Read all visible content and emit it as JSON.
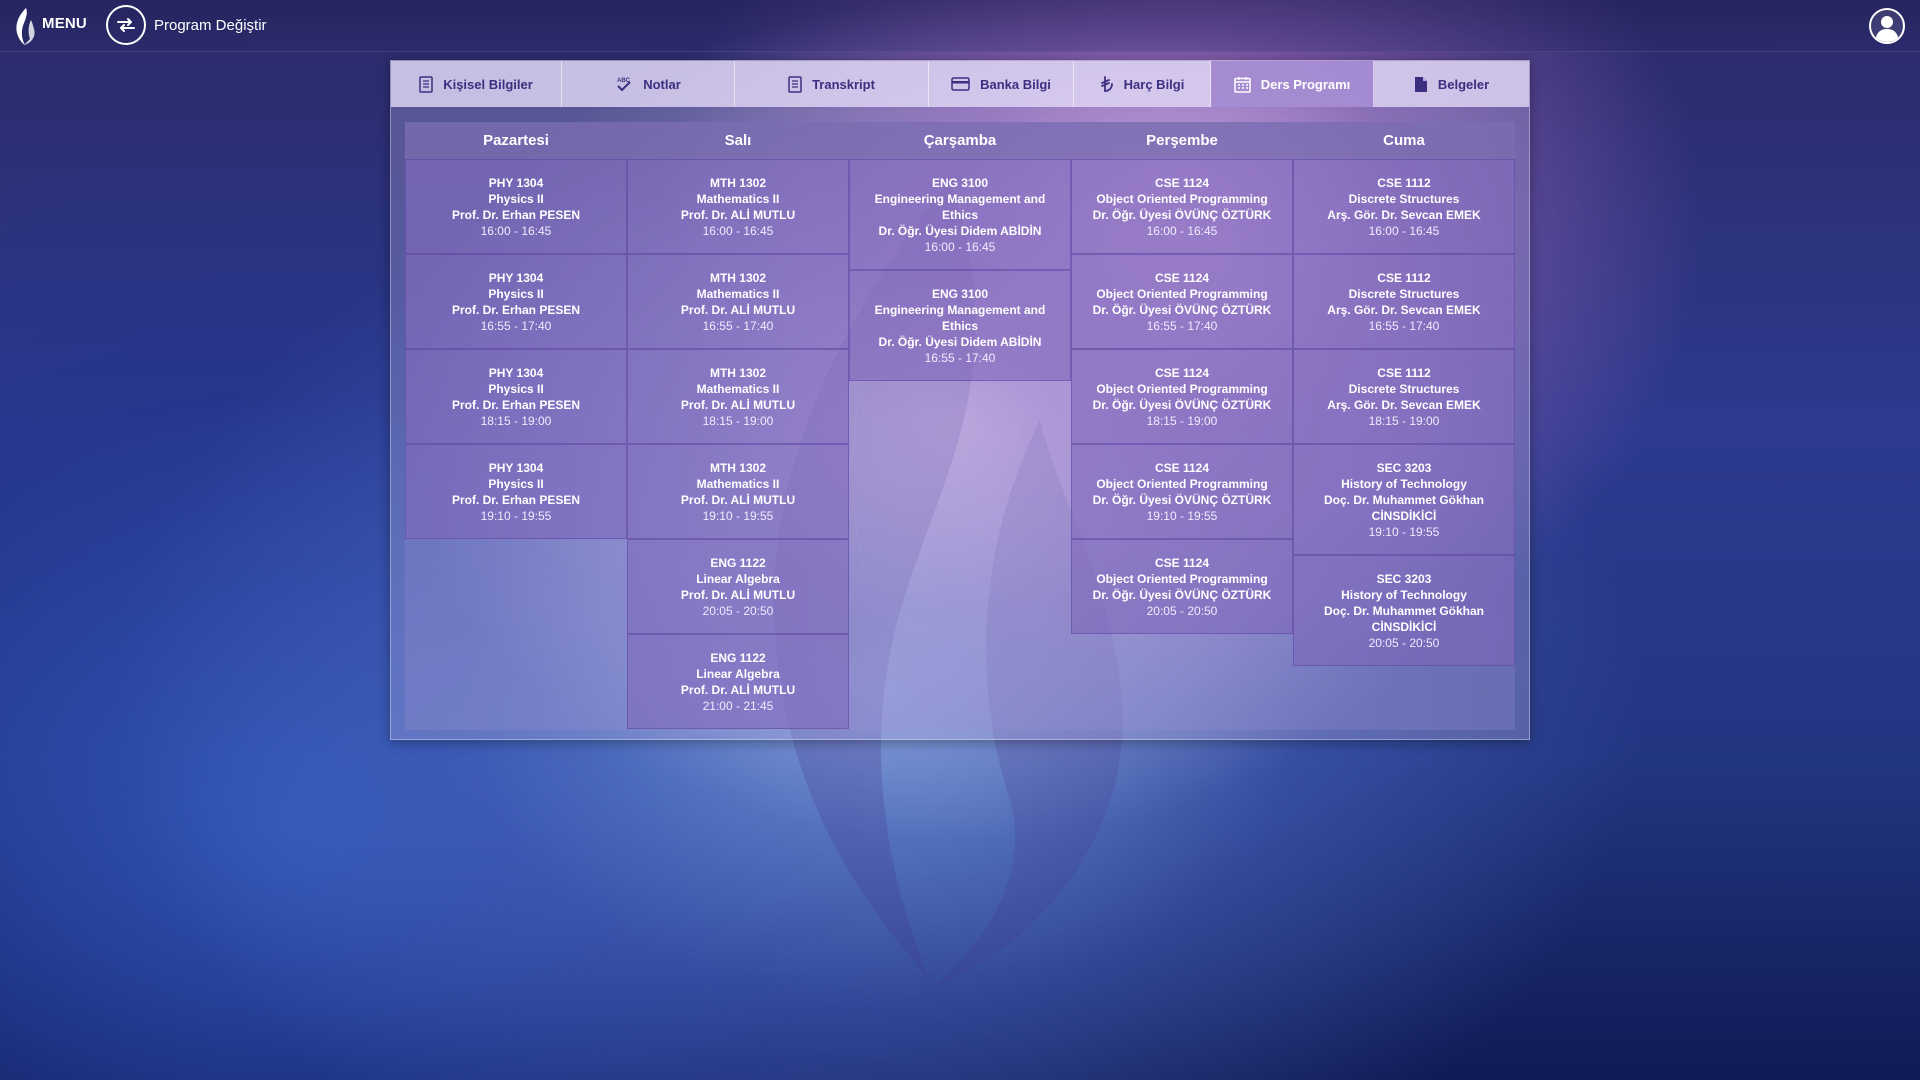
{
  "topbar": {
    "menu_label": "MENU",
    "program_change_label": "Program Değiştir"
  },
  "tabs": [
    {
      "label": "Kişisel Bilgiler",
      "icon": "document-icon"
    },
    {
      "label": "Notlar",
      "icon": "abc-check-icon"
    },
    {
      "label": "Transkript",
      "icon": "document-icon"
    },
    {
      "label": "Banka Bilgi",
      "icon": "credit-card-icon"
    },
    {
      "label": "Harç Bilgi",
      "icon": "lira-icon"
    },
    {
      "label": "Ders Programı",
      "icon": "calendar-icon",
      "active": true
    },
    {
      "label": "Belgeler",
      "icon": "file-icon"
    }
  ],
  "schedule": {
    "days": [
      "Pazartesi",
      "Salı",
      "Çarşamba",
      "Perşembe",
      "Cuma"
    ],
    "columns": [
      [
        {
          "code": "PHY 1304",
          "name": "Physics II",
          "instructor": "Prof. Dr. Erhan PESEN",
          "time": "16:00 - 16:45"
        },
        {
          "code": "PHY 1304",
          "name": "Physics II",
          "instructor": "Prof. Dr. Erhan PESEN",
          "time": "16:55 - 17:40"
        },
        {
          "code": "PHY 1304",
          "name": "Physics II",
          "instructor": "Prof. Dr. Erhan PESEN",
          "time": "18:15 - 19:00"
        },
        {
          "code": "PHY 1304",
          "name": "Physics II",
          "instructor": "Prof. Dr. Erhan PESEN",
          "time": "19:10 - 19:55"
        }
      ],
      [
        {
          "code": "MTH 1302",
          "name": "Mathematics II",
          "instructor": "Prof. Dr. ALİ MUTLU",
          "time": "16:00 - 16:45"
        },
        {
          "code": "MTH 1302",
          "name": "Mathematics II",
          "instructor": "Prof. Dr. ALİ MUTLU",
          "time": "16:55 - 17:40"
        },
        {
          "code": "MTH 1302",
          "name": "Mathematics II",
          "instructor": "Prof. Dr. ALİ MUTLU",
          "time": "18:15 - 19:00"
        },
        {
          "code": "MTH 1302",
          "name": "Mathematics II",
          "instructor": "Prof. Dr. ALİ MUTLU",
          "time": "19:10 - 19:55"
        },
        {
          "code": "ENG 1122",
          "name": "Linear Algebra",
          "instructor": "Prof. Dr. ALİ MUTLU",
          "time": "20:05 - 20:50"
        },
        {
          "code": "ENG 1122",
          "name": "Linear Algebra",
          "instructor": "Prof. Dr. ALİ MUTLU",
          "time": "21:00 - 21:45"
        }
      ],
      [
        {
          "code": "ENG 3100",
          "name": "Engineering Management and Ethics",
          "instructor": "Dr. Öğr. Üyesi Didem ABİDİN",
          "time": "16:00 - 16:45"
        },
        {
          "code": "ENG 3100",
          "name": "Engineering Management and Ethics",
          "instructor": "Dr. Öğr. Üyesi Didem ABİDİN",
          "time": "16:55 - 17:40"
        }
      ],
      [
        {
          "code": "CSE 1124",
          "name": "Object Oriented Programming",
          "instructor": "Dr. Öğr. Üyesi ÖVÜNÇ ÖZTÜRK",
          "time": "16:00 - 16:45"
        },
        {
          "code": "CSE 1124",
          "name": "Object Oriented Programming",
          "instructor": "Dr. Öğr. Üyesi ÖVÜNÇ ÖZTÜRK",
          "time": "16:55 - 17:40"
        },
        {
          "code": "CSE 1124",
          "name": "Object Oriented Programming",
          "instructor": "Dr. Öğr. Üyesi ÖVÜNÇ ÖZTÜRK",
          "time": "18:15 - 19:00"
        },
        {
          "code": "CSE 1124",
          "name": "Object Oriented Programming",
          "instructor": "Dr. Öğr. Üyesi ÖVÜNÇ ÖZTÜRK",
          "time": "19:10 - 19:55"
        },
        {
          "code": "CSE 1124",
          "name": "Object Oriented Programming",
          "instructor": "Dr. Öğr. Üyesi ÖVÜNÇ ÖZTÜRK",
          "time": "20:05 - 20:50"
        }
      ],
      [
        {
          "code": "CSE 1112",
          "name": "Discrete Structures",
          "instructor": "Arş. Gör. Dr. Sevcan EMEK",
          "time": "16:00 - 16:45"
        },
        {
          "code": "CSE 1112",
          "name": "Discrete Structures",
          "instructor": "Arş. Gör. Dr. Sevcan EMEK",
          "time": "16:55 - 17:40"
        },
        {
          "code": "CSE 1112",
          "name": "Discrete Structures",
          "instructor": "Arş. Gör. Dr. Sevcan EMEK",
          "time": "18:15 - 19:00"
        },
        {
          "code": "SEC 3203",
          "name": "History of Technology",
          "instructor": "Doç. Dr. Muhammet Gökhan CİNSDİKİCİ",
          "time": "19:10 - 19:55"
        },
        {
          "code": "SEC 3203",
          "name": "History of Technology",
          "instructor": "Doç. Dr. Muhammet Gökhan CİNSDİKİCİ",
          "time": "20:05 - 20:50"
        }
      ]
    ]
  }
}
